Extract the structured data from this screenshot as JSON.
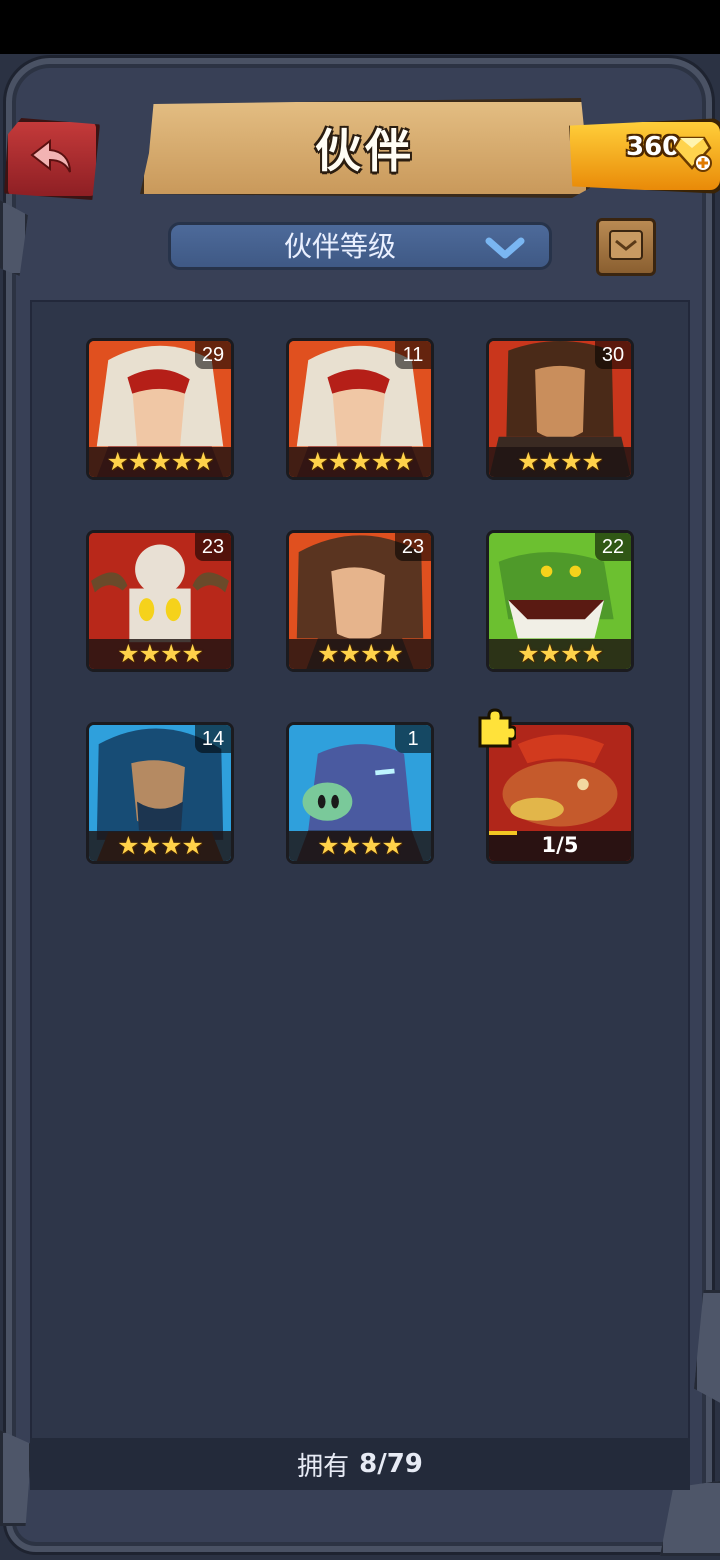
{
  "header": {
    "title": "伙伴",
    "gems": "360"
  },
  "sort": {
    "label": "伙伴等级"
  },
  "companions": [
    {
      "level": "29",
      "stars": "★★★★★",
      "theme": "red",
      "icon": "white-hair-woman-portrait"
    },
    {
      "level": "11",
      "stars": "★★★★★",
      "theme": "red",
      "icon": "white-hair-woman-portrait"
    },
    {
      "level": "30",
      "stars": "★★★★",
      "theme": "red",
      "icon": "barbarian-man-portrait"
    },
    {
      "level": "23",
      "stars": "★★★★",
      "theme": "red",
      "icon": "skull-mask-shaman-portrait"
    },
    {
      "level": "23",
      "stars": "★★★★",
      "theme": "red",
      "icon": "brown-hair-woman-portrait"
    },
    {
      "level": "22",
      "stars": "★★★★",
      "theme": "green",
      "icon": "crocodile-monster-portrait"
    },
    {
      "level": "14",
      "stars": "★★★★",
      "theme": "blue",
      "icon": "blue-hair-warrior-portrait"
    },
    {
      "level": "1",
      "stars": "★★★★",
      "theme": "blue",
      "icon": "boar-beast-portrait"
    }
  ],
  "fragment": {
    "progress_text": "1/5",
    "progress": 0.2,
    "icon": "toad-monster-portrait"
  },
  "footer": {
    "label": "拥有",
    "count": "8/79"
  },
  "colors": {
    "red": "#d9401f",
    "green": "#5fb52c",
    "blue": "#2a8fd0",
    "star": "#ffd24a"
  }
}
